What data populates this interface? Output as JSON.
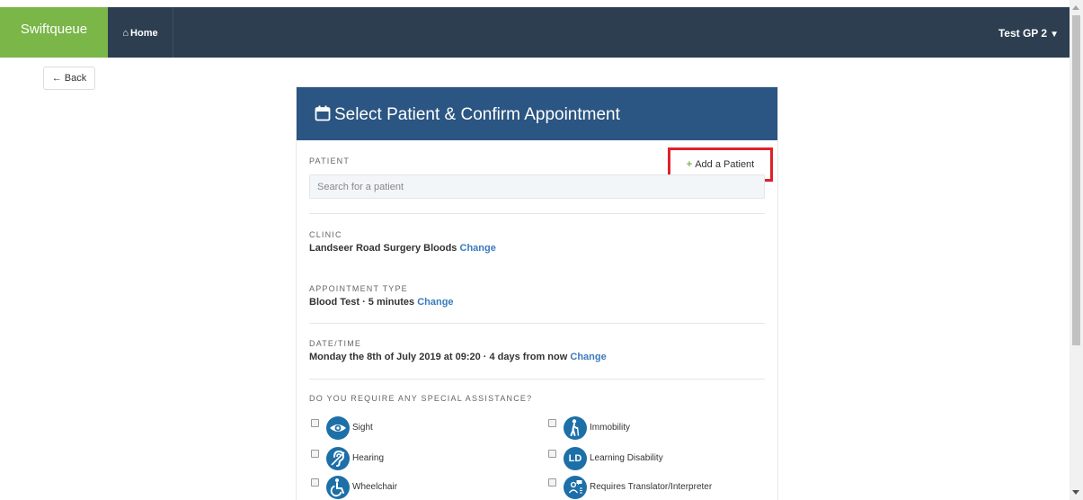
{
  "topbar": {
    "brand": "Swiftqueue",
    "home_label": "Home",
    "home_icon": "home-icon",
    "user_label": "Test GP 2",
    "user_icon": "chevron-down-icon",
    "bg_color": "#2c3e50",
    "brand_color": "#7ab648"
  },
  "back": {
    "label": "Back",
    "icon": "arrow-left-icon"
  },
  "card": {
    "title": "Select Patient & Confirm Appointment",
    "title_icon": "calendar-icon",
    "header_color": "#2b5582",
    "patient": {
      "label": "PATIENT",
      "add_label": "Add a Patient",
      "search_placeholder": "Search for a patient"
    },
    "clinic": {
      "label": "CLINIC",
      "value": "Landseer Road Surgery Bloods",
      "change": "Change"
    },
    "appointment_type": {
      "label": "APPOINTMENT TYPE",
      "value": "Blood Test · 5 minutes",
      "change": "Change"
    },
    "datetime": {
      "label": "DATE/TIME",
      "value": "Monday the 8th of July 2019 at 09:20 · 4 days from now",
      "change": "Change"
    },
    "assistance": {
      "label": "DO YOU REQUIRE ANY SPECIAL ASSISTANCE?",
      "options": [
        {
          "label": "Sight",
          "icon": "eye-icon"
        },
        {
          "label": "Immobility",
          "icon": "walking-cane-icon"
        },
        {
          "label": "Hearing",
          "icon": "ear-icon"
        },
        {
          "label": "Learning Disability",
          "icon": "ld-icon",
          "badge_text": "LD"
        },
        {
          "label": "Wheelchair",
          "icon": "wheelchair-icon"
        },
        {
          "label": "Requires Translator/Interpreter",
          "icon": "translator-icon"
        }
      ]
    }
  }
}
